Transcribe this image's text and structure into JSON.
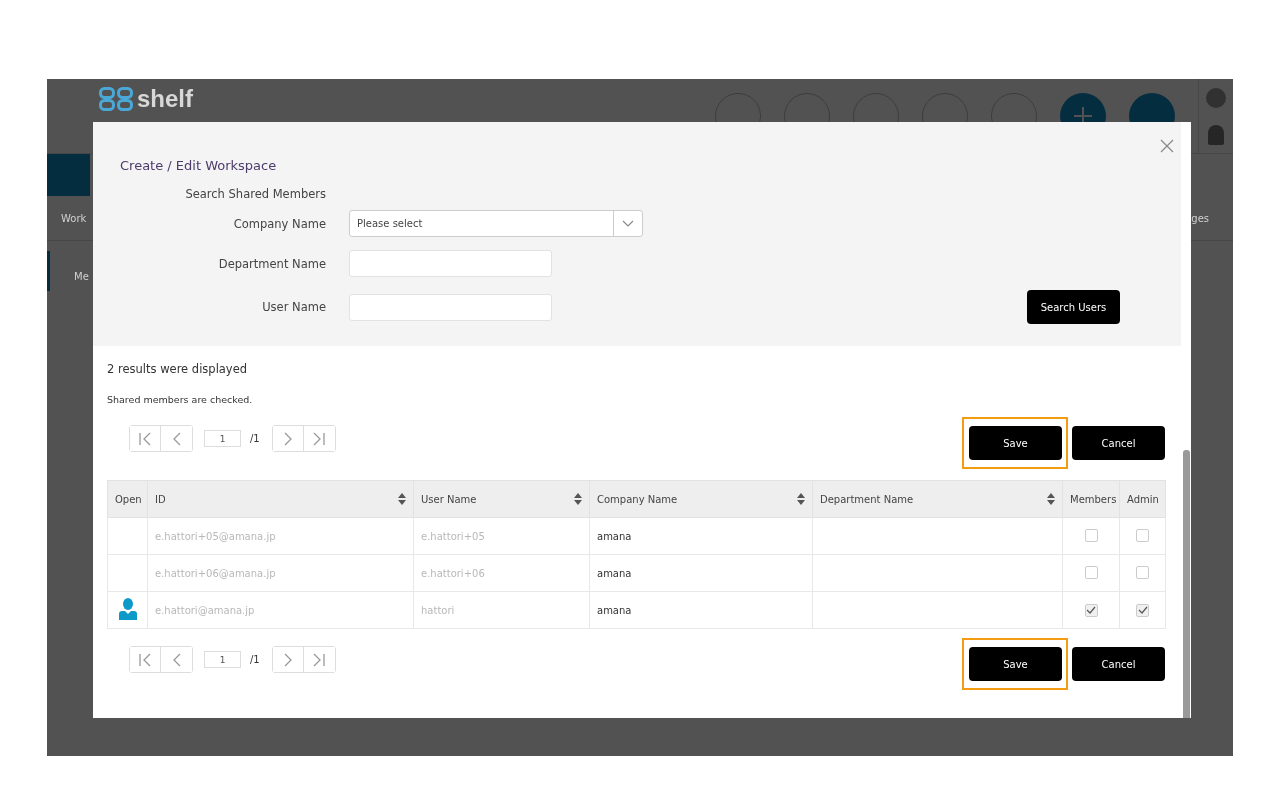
{
  "background_app": {
    "logo": "shelf",
    "tab_partial": "Work",
    "sidebar_partial": "Me",
    "right_partial": "ges"
  },
  "dialog": {
    "title": "Create / Edit Workspace",
    "section_label": "Search Shared Members",
    "fields": [
      {
        "label": "Company Name",
        "kind": "select",
        "placeholder": "Please select"
      },
      {
        "label": "Department Name",
        "kind": "text"
      },
      {
        "label": "User Name",
        "kind": "text"
      }
    ],
    "search_button": "Search Users",
    "result_count": "2 results were displayed",
    "note": "Shared members are checked.",
    "top_pager": {
      "page": "1",
      "total": "/1"
    },
    "top_buttons": [
      {
        "label": "Save",
        "highlighted": true
      },
      {
        "label": "Cancel",
        "highlighted": false
      }
    ],
    "table": {
      "columns": [
        {
          "label": "Open",
          "sortable": false
        },
        {
          "label": "ID",
          "sortable": true
        },
        {
          "label": "User Name",
          "sortable": true
        },
        {
          "label": "Company Name",
          "sortable": true
        },
        {
          "label": "Department Name",
          "sortable": true
        },
        {
          "label": "Members",
          "sortable": false
        },
        {
          "label": "Admin",
          "sortable": false
        }
      ],
      "rows": [
        {
          "has_profile": false,
          "id": "e.hattori+05@amana.jp",
          "user_name": "e.hattori+05",
          "company": "amana",
          "members": false,
          "admin": false
        },
        {
          "has_profile": false,
          "id": "e.hattori+06@amana.jp",
          "user_name": "e.hattori+06",
          "company": "amana",
          "members": false,
          "admin": false
        },
        {
          "has_profile": true,
          "id": "e.hattori@amana.jp",
          "user_name": "hattori",
          "company": "amana",
          "members": true,
          "admin": true
        }
      ]
    },
    "bottom_pager": {
      "page": "1",
      "total": "/1"
    },
    "bottom_buttons": [
      {
        "label": "Save",
        "highlighted": true
      },
      {
        "label": "Cancel",
        "highlighted": false
      }
    ]
  }
}
